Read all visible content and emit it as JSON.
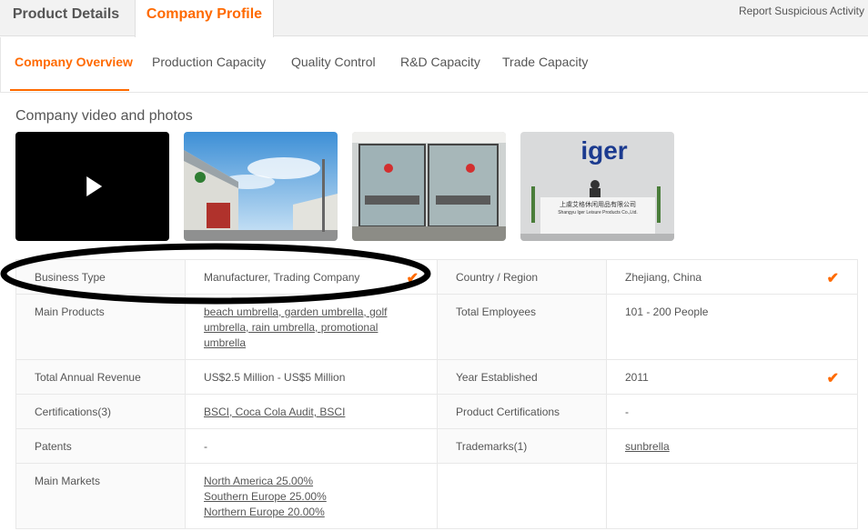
{
  "tabs": {
    "product_details": "Product Details",
    "company_profile": "Company Profile"
  },
  "report_link": "Report Suspicious Activity",
  "sub_nav": {
    "company_overview": "Company Overview",
    "production_capacity": "Production Capacity",
    "quality_control": "Quality Control",
    "rd_capacity": "R&D Capacity",
    "trade_capacity": "Trade Capacity"
  },
  "media": {
    "title": "Company video and photos",
    "logo_text": "iger",
    "sign_cn": "上虞艾格休闲用品有限公司",
    "sign_en": "Shangyu Iger Leisure Products Co.,Ltd."
  },
  "info": {
    "business_type_label": "Business Type",
    "business_type_value": "Manufacturer, Trading Company",
    "country_label": "Country / Region",
    "country_value": "Zhejiang, China",
    "main_products_label": "Main Products",
    "main_products_value": "beach umbrella, garden umbrella, golf umbrella, rain umbrella, promotional umbrella",
    "employees_label": "Total Employees",
    "employees_value": "101 - 200 People",
    "revenue_label": "Total Annual Revenue",
    "revenue_value": "US$2.5 Million - US$5 Million",
    "year_label": "Year Established",
    "year_value": "2011",
    "certifications_label": "Certifications(3)",
    "certifications_value": "BSCI, Coca Cola Audit, BSCI",
    "product_cert_label": "Product Certifications",
    "product_cert_value": "-",
    "patents_label": "Patents",
    "patents_value": "-",
    "trademarks_label": "Trademarks(1)",
    "trademarks_value": "sunbrella",
    "markets_label": "Main Markets",
    "markets": [
      "North America 25.00%",
      "Southern Europe 25.00%",
      "Northern Europe 20.00%"
    ]
  },
  "colors": {
    "accent": "#ff6a00",
    "check": "#ff6a00"
  },
  "icons": {
    "play": "play-icon",
    "check": "check-icon"
  }
}
